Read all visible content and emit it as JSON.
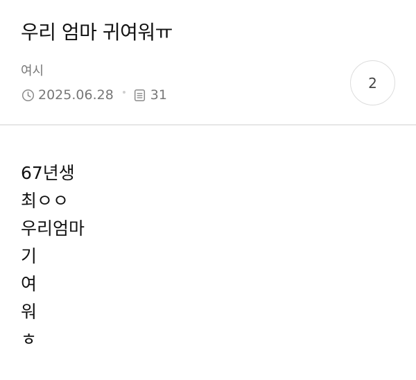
{
  "post": {
    "title": "우리 엄마 귀여워ㅠ",
    "author": "여시",
    "date": "2025.06.28",
    "views": "31",
    "comment_count": "2",
    "icons": {
      "date": "clock-icon",
      "views": "document-icon"
    },
    "body_lines": [
      "67년생",
      "최ㅇㅇ",
      "우리엄마",
      "기",
      "여",
      "워",
      "ㅎ"
    ]
  }
}
